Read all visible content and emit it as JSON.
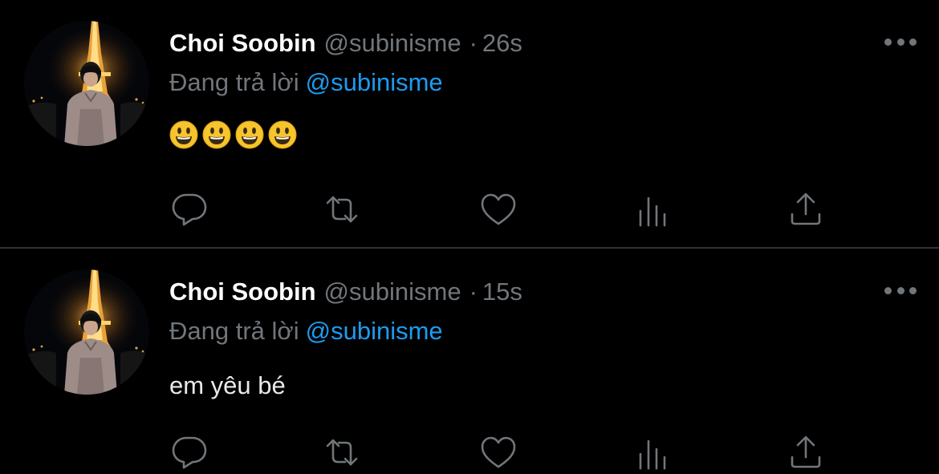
{
  "colors": {
    "background": "#000000",
    "name": "#ffffff",
    "muted": "#71767b",
    "mention": "#1d9bf0",
    "divider": "#2f3336"
  },
  "tweets": [
    {
      "display_name": "Choi Soobin",
      "handle": "@subinisme",
      "separator": "·",
      "time": "26s",
      "reply_prefix": "Đang trả lời",
      "reply_to": "@subinisme",
      "body": "",
      "emojis": [
        "😃",
        "😃",
        "😃",
        "😃"
      ],
      "actions": [
        "reply-icon",
        "retweet-icon",
        "like-icon",
        "views-icon",
        "share-icon"
      ],
      "more_icon": "more-icon"
    },
    {
      "display_name": "Choi Soobin",
      "handle": "@subinisme",
      "separator": "·",
      "time": "15s",
      "reply_prefix": "Đang trả lời",
      "reply_to": "@subinisme",
      "body": "em yêu bé",
      "emojis": [],
      "actions": [
        "reply-icon",
        "retweet-icon",
        "like-icon",
        "views-icon",
        "share-icon"
      ],
      "more_icon": "more-icon"
    }
  ]
}
